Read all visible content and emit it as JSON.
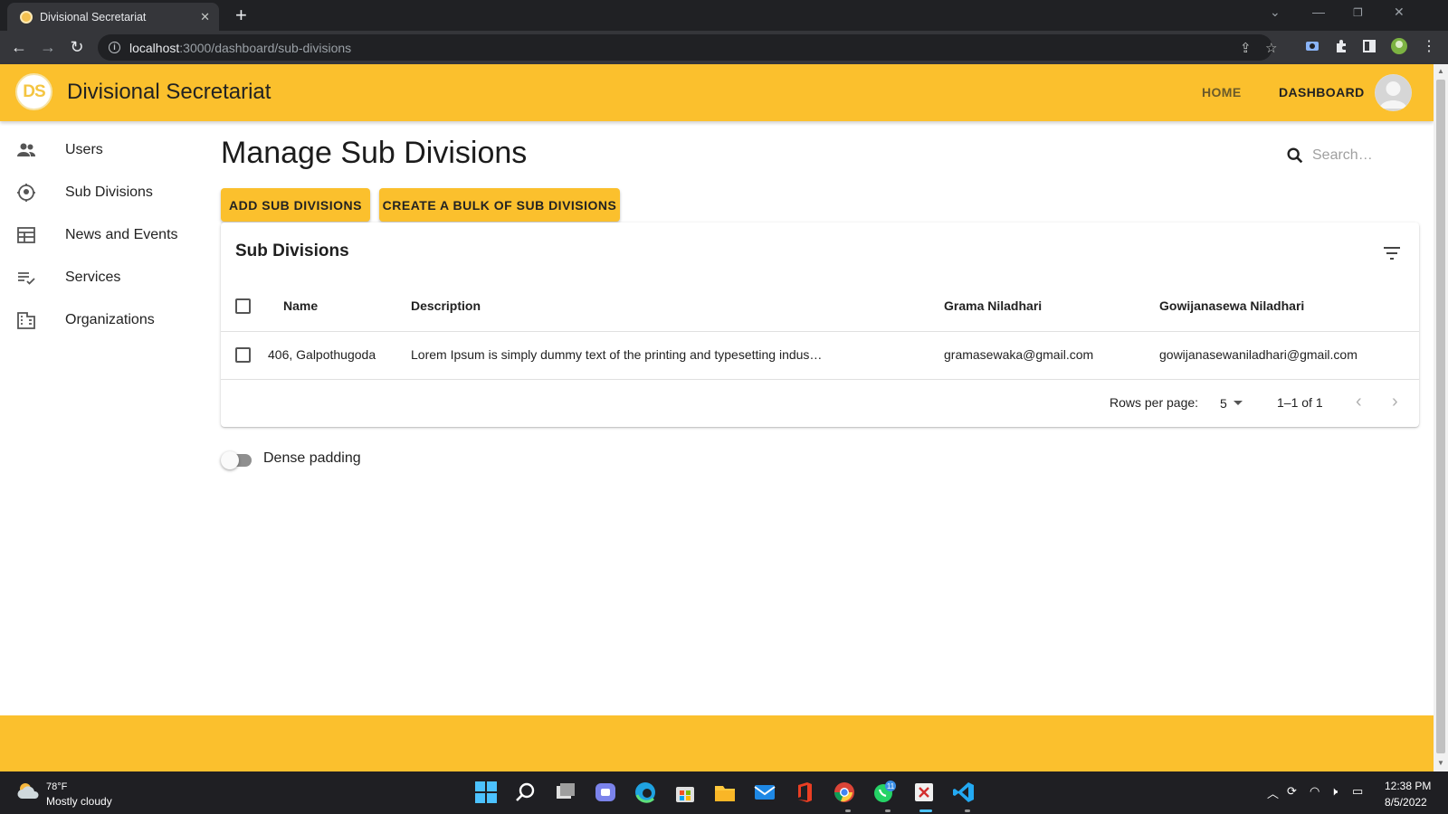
{
  "browser": {
    "tab_title": "Divisional Secretariat",
    "url_host": "localhost",
    "url_path": ":3000/dashboard/sub-divisions"
  },
  "header": {
    "logo_text": "DS",
    "title": "Divisional Secretariat",
    "nav": {
      "home": "HOME",
      "dashboard": "DASHBOARD"
    }
  },
  "sidebar": {
    "items": [
      {
        "label": "Users",
        "icon": "people-icon"
      },
      {
        "label": "Sub Divisions",
        "icon": "location-icon"
      },
      {
        "label": "News and Events",
        "icon": "calendar-icon"
      },
      {
        "label": "Services",
        "icon": "checklist-icon"
      },
      {
        "label": "Organizations",
        "icon": "building-icon"
      }
    ]
  },
  "main": {
    "title": "Manage Sub Divisions",
    "search_placeholder": "Search…",
    "buttons": {
      "add": "ADD SUB DIVISIONS",
      "bulk": "CREATE A BULK OF SUB DIVISIONS"
    },
    "table": {
      "title": "Sub Divisions",
      "columns": [
        "Name",
        "Description",
        "Grama Niladhari",
        "Gowijanasewa Niladhari"
      ],
      "rows": [
        {
          "name": "406, Galpothugoda",
          "description": "Lorem Ipsum is simply dummy text of the printing and typesetting indus…",
          "grama": "gramasewaka@gmail.com",
          "gowijana": "gowijanasewaniladhari@gmail.com"
        }
      ],
      "rows_per_page_label": "Rows per page:",
      "rows_per_page": "5",
      "page_range": "1–1 of 1"
    },
    "dense_label": "Dense padding",
    "dense_enabled": false
  },
  "taskbar": {
    "weather_temp": "78°F",
    "weather_desc": "Mostly cloudy",
    "whatsapp_badge": "11",
    "time": "12:38 PM",
    "date": "8/5/2022"
  },
  "colors": {
    "accent": "#fbc02d",
    "chrome_dark": "#202124"
  }
}
